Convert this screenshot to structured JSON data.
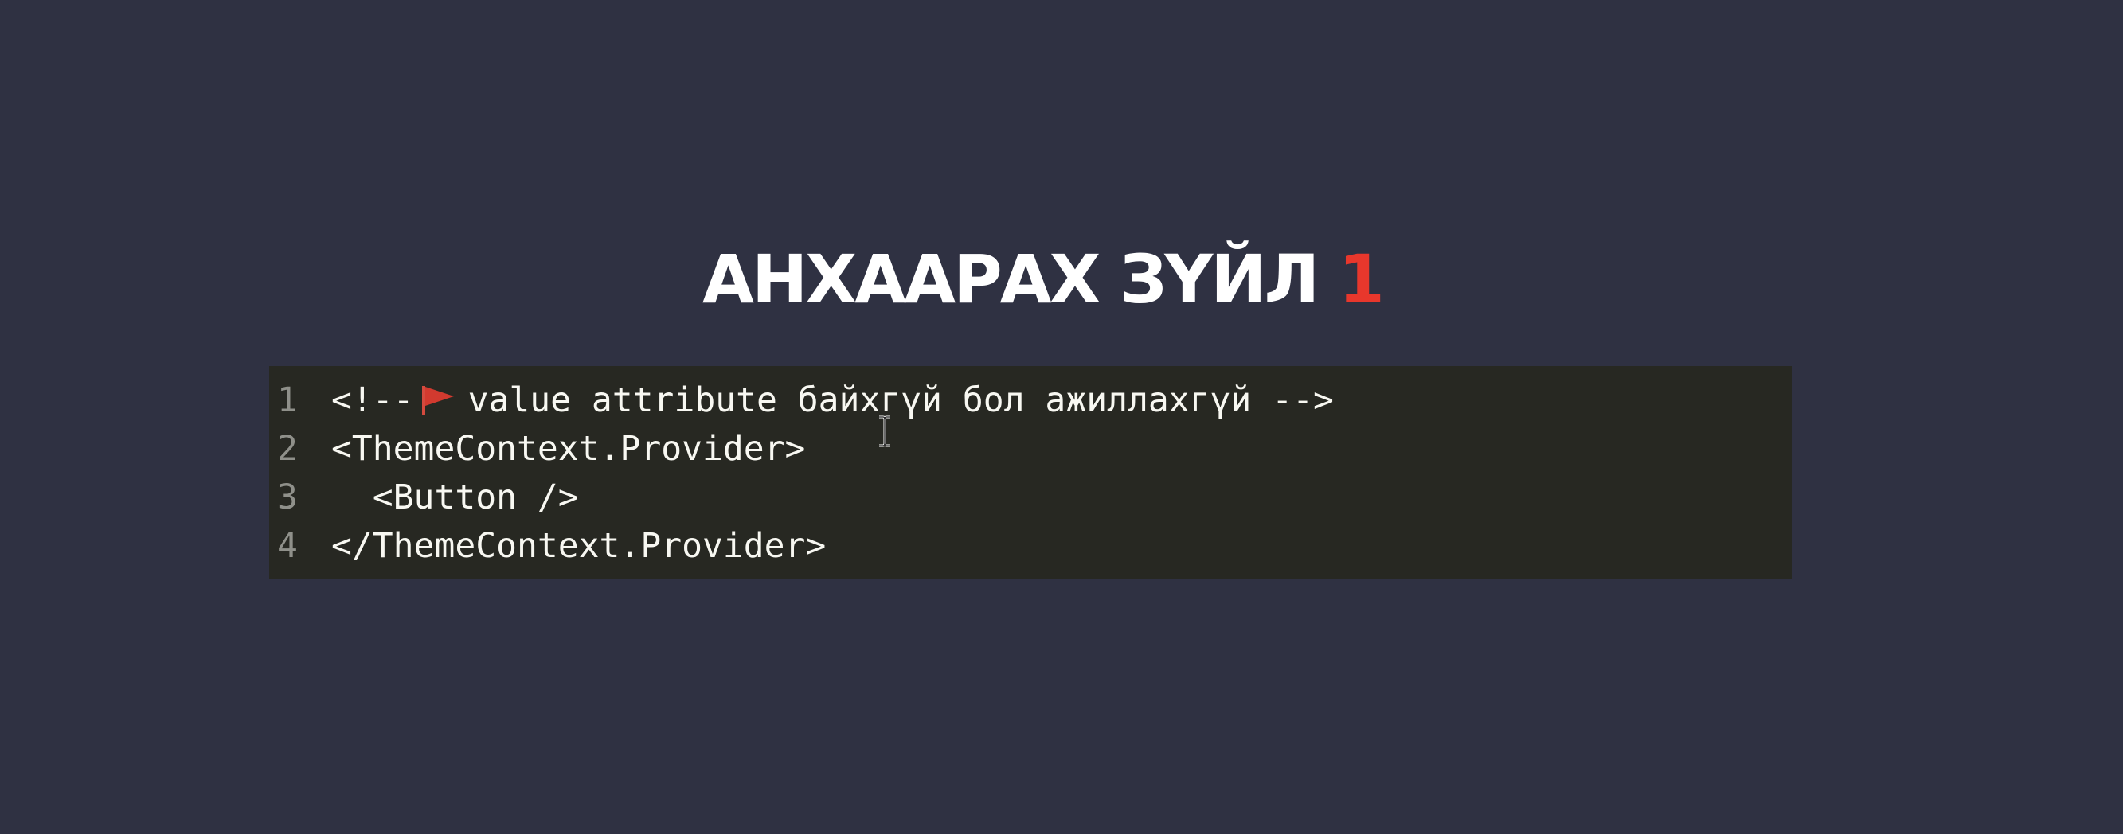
{
  "slide": {
    "title_text": "АНХААРАХ ЗҮЙЛ",
    "title_number": "1",
    "accent_color": "#e8372c"
  },
  "code": {
    "lines": [
      {
        "number": "1",
        "before_icon": "<!--",
        "icon": "red-flag-icon",
        "after_icon": "value attribute байхгүй бол ажиллахгүй -->"
      },
      {
        "number": "2",
        "text": "<ThemeContext.Provider>"
      },
      {
        "number": "3",
        "text": "  <Button />"
      },
      {
        "number": "4",
        "text": "</ThemeContext.Provider>"
      }
    ]
  },
  "cursor": {
    "icon": "text-cursor-icon"
  }
}
